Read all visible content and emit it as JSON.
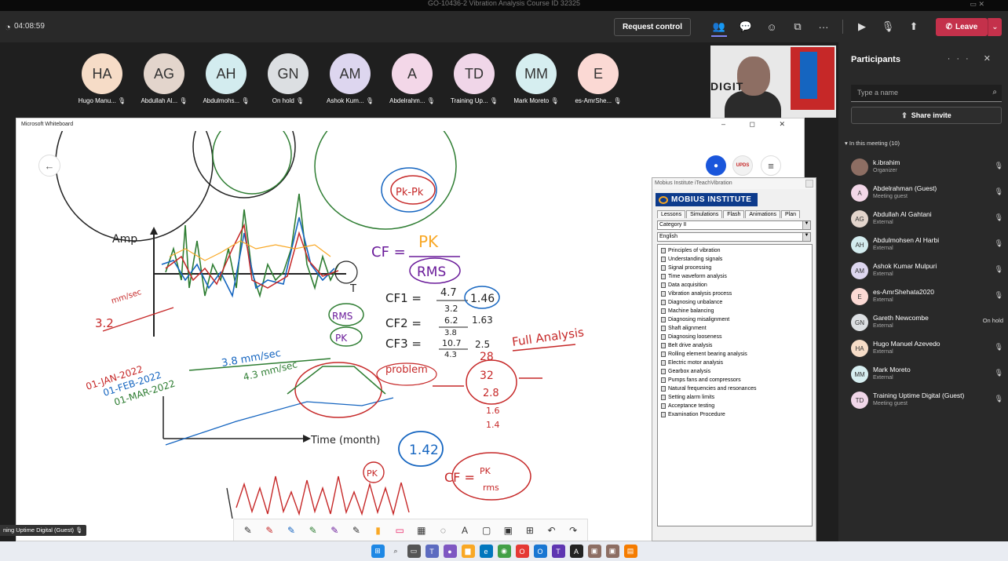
{
  "window": {
    "title": "GO-10436-2 Vibration Analysis Course ID 32325"
  },
  "topbar": {
    "timer": "04:08:59",
    "request_control": "Request control",
    "leave": "Leave"
  },
  "attendees": [
    {
      "initials": "HA",
      "name": "Hugo Manu...",
      "color": "#f6dcc7"
    },
    {
      "initials": "AG",
      "name": "Abdullah Al...",
      "color": "#e3d5cc"
    },
    {
      "initials": "AH",
      "name": "Abdulmohs...",
      "color": "#d3ecef"
    },
    {
      "initials": "GN",
      "name": "On hold",
      "color": "#dcdfe2"
    },
    {
      "initials": "AM",
      "name": "Ashok Kum...",
      "color": "#ddd6ef"
    },
    {
      "initials": "A",
      "name": "Abdelrahm...",
      "color": "#f3d7e8"
    },
    {
      "initials": "TD",
      "name": "Training Up...",
      "color": "#f0d6e8"
    },
    {
      "initials": "MM",
      "name": "Mark Moreto",
      "color": "#d6eef0"
    },
    {
      "initials": "E",
      "name": "es-AmrShe...",
      "color": "#fbd9d4"
    }
  ],
  "video": {
    "logo_text": "DIGIT"
  },
  "whiteboard": {
    "title": "Microsoft Whiteboard",
    "up_button": "UPDS"
  },
  "mobius": {
    "window_title": "Mobius Institute iTeachVibration",
    "logo": "MOBIUS INSTITUTE",
    "tabs": [
      "Lessons",
      "Simulations",
      "Flash",
      "Animations",
      "Plan"
    ],
    "category": "Category II",
    "language": "English",
    "lessons": [
      "Principles of vibration",
      "Understanding signals",
      "Signal processing",
      "Time waveform analysis",
      "Data acquisition",
      "Vibration analysis process",
      "Diagnosing unbalance",
      "Machine balancing",
      "Diagnosing misalignment",
      "Shaft alignment",
      "Diagnosing looseness",
      "Belt drive analysis",
      "Rolling element bearing analysis",
      "Electric motor analysis",
      "Gearbox analysis",
      "Pumps fans and compressors",
      "Natural frequencies and resonances",
      "Setting alarm limits",
      "Acceptance testing",
      "Examination Procedure"
    ]
  },
  "participants_panel": {
    "title": "Participants",
    "search_placeholder": "Type a name",
    "share_invite": "Share invite",
    "section": "In this meeting (10)",
    "people": [
      {
        "initials": "",
        "name": "k.ibrahim",
        "role": "Organizer",
        "color": "#8d6e63",
        "status": ""
      },
      {
        "initials": "A",
        "name": "Abdelrahman (Guest)",
        "role": "Meeting guest",
        "color": "#f3d7e8",
        "status": ""
      },
      {
        "initials": "AG",
        "name": "Abdullah Al Gahtani",
        "role": "External",
        "color": "#e3d5cc",
        "status": ""
      },
      {
        "initials": "AH",
        "name": "Abdulmohsen Al Harbi",
        "role": "External",
        "color": "#d3ecef",
        "status": ""
      },
      {
        "initials": "AM",
        "name": "Ashok Kumar Mulpuri",
        "role": "External",
        "color": "#ddd6ef",
        "status": ""
      },
      {
        "initials": "E",
        "name": "es-AmrShehata2020",
        "role": "External",
        "color": "#fbd9d4",
        "status": ""
      },
      {
        "initials": "GN",
        "name": "Gareth Newcombe",
        "role": "External",
        "color": "#dcdfe2",
        "status": "On hold"
      },
      {
        "initials": "HA",
        "name": "Hugo Manuel Azevedo",
        "role": "External",
        "color": "#f6dcc7",
        "status": ""
      },
      {
        "initials": "MM",
        "name": "Mark Moreto",
        "role": "External",
        "color": "#d6eef0",
        "status": ""
      },
      {
        "initials": "TD",
        "name": "Training Uptime Digital (Guest)",
        "role": "Meeting guest",
        "color": "#f0d6e8",
        "status": ""
      }
    ]
  },
  "caption": "ning Uptime Digital (Guest)",
  "ink": {
    "amp": "Amp",
    "t": "T",
    "cf": "CF =",
    "pk": "PK",
    "rms": "RMS",
    "cf1": "CF1 =",
    "cf1_val": "4.7",
    "cf1_den": "3.2",
    "cf1_res": "1.46",
    "cf2": "CF2 =",
    "cf2_val": "6.2",
    "cf2_den": "3.8",
    "cf2_res": "1.63",
    "cf3": "CF3 =",
    "cf3_val": "10.7",
    "cf3_den": "4.3",
    "cf3_res": "2.5",
    "full": "Full Analysis",
    "mmsec1": "mm/sec",
    "v32": "3.2",
    "v38": "3.8 mm/sec",
    "v43": "4.3 mm/sec",
    "d1": "01-JAN-2022",
    "d2": "01-FEB-2022",
    "d3": "01-MAR-2022",
    "problem": "problem",
    "time": "Time (month)",
    "n28a": "28",
    "n32": "32",
    "n28b": "2.8",
    "n16": "1.6",
    "n14": "1.4",
    "n142": "1.42",
    "pkc": "PK",
    "cf_pk": "CF =",
    "cf_pk_top": "PK",
    "cf_pk_bot": "rms",
    "rms_circ": "RMS",
    "pk_circ": "PK"
  }
}
